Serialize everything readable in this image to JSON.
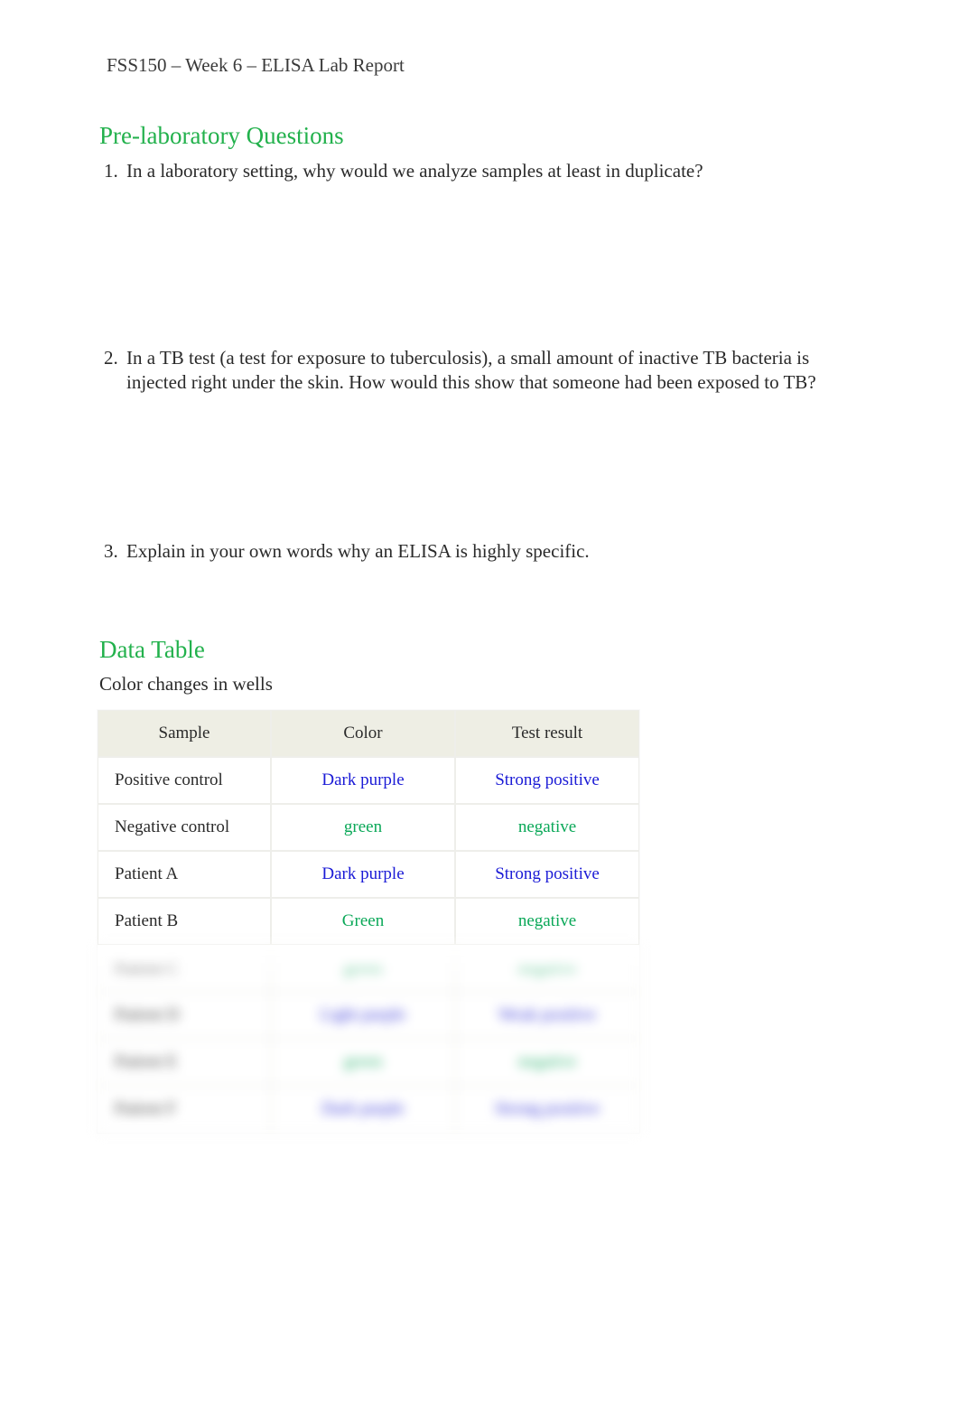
{
  "header": {
    "title": "FSS150 – Week 6 – ELISA Lab Report"
  },
  "sections": {
    "prelab_heading": "Pre-laboratory Questions",
    "data_table_heading": "Data Table",
    "data_table_sub": "Color changes in wells"
  },
  "questions": {
    "q1": "In a laboratory setting, why would we analyze samples at least in duplicate?",
    "q2": "In a TB test (a test for exposure to tuberculosis), a small amount of inactive TB bacteria is injected right under the skin. How would this show that someone had been exposed to TB?",
    "q3": "Explain in your own words why an ELISA is highly specific."
  },
  "table": {
    "columns": {
      "sample": "Sample",
      "color": "Color",
      "result": "Test result"
    },
    "rows": [
      {
        "sample": "Positive control",
        "color": "Dark purple",
        "color_style": "blue",
        "result": "Strong positive",
        "result_style": "blue"
      },
      {
        "sample": "Negative control",
        "color": "green",
        "color_style": "green",
        "result": "negative",
        "result_style": "green"
      },
      {
        "sample": "Patient A",
        "color": "Dark purple",
        "color_style": "blue",
        "result": "Strong positive",
        "result_style": "blue"
      },
      {
        "sample": "Patient B",
        "color": "Green",
        "color_style": "green",
        "result": "negative",
        "result_style": "green"
      }
    ],
    "obscured_rows": [
      {
        "sample": "Patient C",
        "color": "green",
        "color_style": "green",
        "result": "negative",
        "result_style": "green"
      },
      {
        "sample": "Patient D",
        "color": "Light purple",
        "color_style": "blue",
        "result": "Weak positive",
        "result_style": "blue"
      },
      {
        "sample": "Patient E",
        "color": "green",
        "color_style": "green",
        "result": "negative",
        "result_style": "green"
      },
      {
        "sample": "Patient F",
        "color": "Dark purple",
        "color_style": "blue",
        "result": "Strong positive",
        "result_style": "blue"
      }
    ]
  }
}
